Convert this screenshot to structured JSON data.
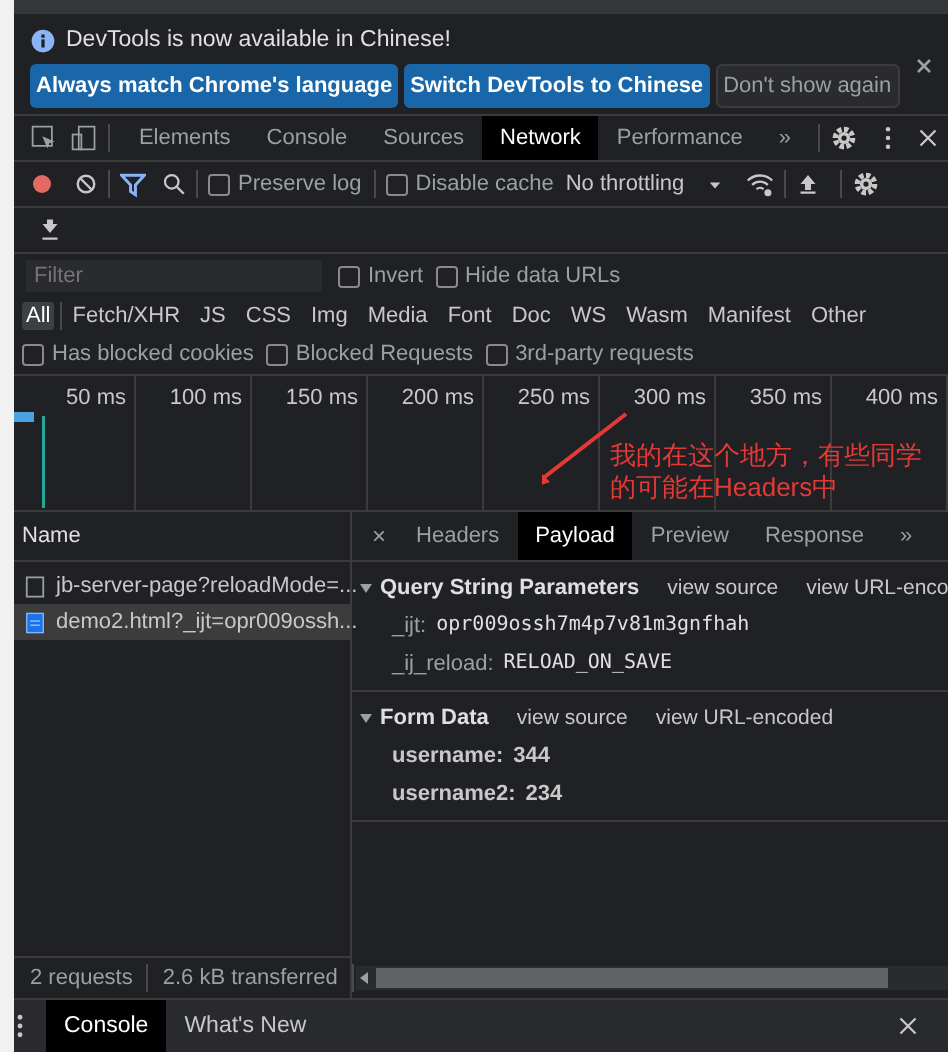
{
  "infobar": {
    "message": "DevTools is now available in Chinese!",
    "buttons": [
      {
        "label": "Always match Chrome's language",
        "kind": "primary"
      },
      {
        "label": "Switch DevTools to Chinese",
        "kind": "primary"
      },
      {
        "label": "Don't show again",
        "kind": "plain"
      }
    ]
  },
  "tabs": [
    {
      "label": "Elements",
      "selected": false
    },
    {
      "label": "Console",
      "selected": false
    },
    {
      "label": "Sources",
      "selected": false
    },
    {
      "label": "Network",
      "selected": true
    },
    {
      "label": "Performance",
      "selected": false
    }
  ],
  "toolbar": {
    "overflow": "»",
    "checkboxes": [
      {
        "label": "Preserve log",
        "checked": false
      },
      {
        "label": "Disable cache",
        "checked": false
      }
    ],
    "throttling": "No throttling"
  },
  "filter": {
    "placeholder": "Filter",
    "checkboxes": [
      {
        "label": "Invert",
        "checked": false
      },
      {
        "label": "Hide data URLs",
        "checked": false
      }
    ]
  },
  "type_filters": [
    {
      "label": "All",
      "selected": true
    },
    {
      "label": "Fetch/XHR",
      "selected": false
    },
    {
      "label": "JS",
      "selected": false
    },
    {
      "label": "CSS",
      "selected": false
    },
    {
      "label": "Img",
      "selected": false
    },
    {
      "label": "Media",
      "selected": false
    },
    {
      "label": "Font",
      "selected": false
    },
    {
      "label": "Doc",
      "selected": false
    },
    {
      "label": "WS",
      "selected": false
    },
    {
      "label": "Wasm",
      "selected": false
    },
    {
      "label": "Manifest",
      "selected": false
    },
    {
      "label": "Other",
      "selected": false
    }
  ],
  "blocked_filters": [
    {
      "label": "Has blocked cookies",
      "checked": false
    },
    {
      "label": "Blocked Requests",
      "checked": false
    },
    {
      "label": "3rd-party requests",
      "checked": false
    }
  ],
  "timeline": {
    "ticks": [
      "50 ms",
      "100 ms",
      "150 ms",
      "200 ms",
      "250 ms",
      "300 ms",
      "350 ms",
      "400 ms"
    ]
  },
  "annotation": {
    "lines": [
      "我的在这个地方，有些同学",
      "的可能在Headers中"
    ]
  },
  "requests": {
    "column": "Name",
    "rows": [
      {
        "name": "jb-server-page?reloadMode=...",
        "selected": false
      },
      {
        "name": "demo2.html?_ijt=opr009ossh...",
        "selected": true
      }
    ]
  },
  "detail": {
    "close": "×",
    "overflow": "»",
    "tabs": [
      {
        "label": "Headers",
        "selected": false
      },
      {
        "label": "Payload",
        "selected": true
      },
      {
        "label": "Preview",
        "selected": false
      },
      {
        "label": "Response",
        "selected": false
      }
    ],
    "sections": [
      {
        "title": "Query String Parameters",
        "expanded": true,
        "links": [
          "view source",
          "view URL-enco"
        ],
        "kind": "mono",
        "params": [
          {
            "key": "_ijt:",
            "value": "opr009ossh7m4p7v81m3gnfhah"
          },
          {
            "key": "_ij_reload:",
            "value": "RELOAD_ON_SAVE"
          }
        ]
      },
      {
        "title": "Form Data",
        "expanded": true,
        "links": [
          "view source",
          "view URL-encoded"
        ],
        "kind": "bold",
        "params": [
          {
            "key": "username:",
            "value": "344"
          },
          {
            "key": "username2:",
            "value": "234"
          }
        ]
      }
    ]
  },
  "status": [
    "2 requests",
    "2.6 kB transferred"
  ],
  "drawer": {
    "tabs": [
      {
        "label": "Console",
        "selected": true
      },
      {
        "label": "What's New",
        "selected": false
      }
    ]
  }
}
